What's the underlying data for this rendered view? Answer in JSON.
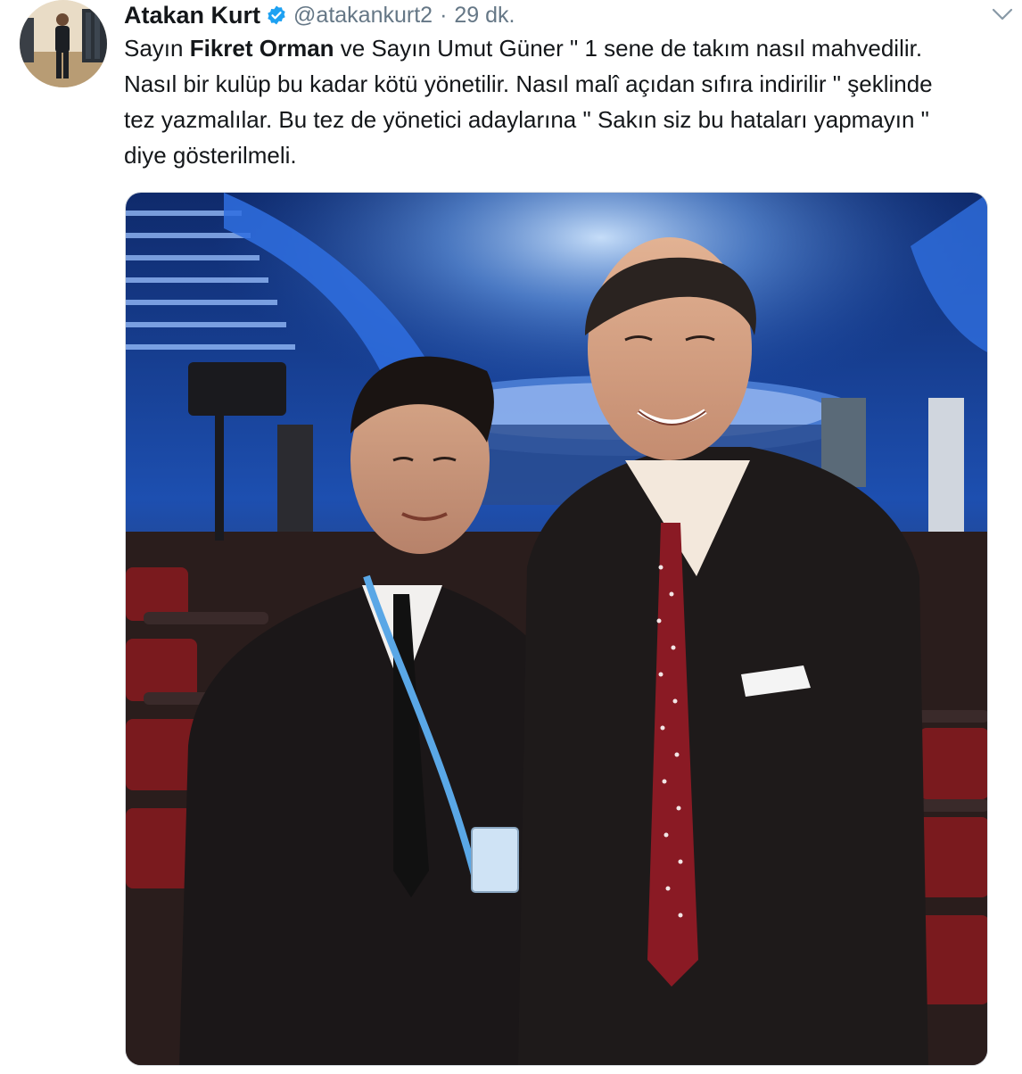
{
  "tweet": {
    "display_name": "Atakan Kurt",
    "handle": "@atakankurt2",
    "separator": "·",
    "timestamp": "29 dk.",
    "verified_icon": "verified-badge-icon",
    "more_icon": "chevron-down-icon",
    "text_lines": [
      {
        "pre": "Sayın ",
        "bold": "Fikret Orman",
        "post": " ve Sayın Umut Güner \" 1 sene de takım nasıl mahvedilir."
      },
      {
        "pre": "Nasıl bir kulüp bu kadar kötü yönetilir. Nasıl malî açıdan sıfıra indirilir \" şeklinde",
        "bold": "",
        "post": ""
      },
      {
        "pre": "tez yazmalılar. Bu tez de yönetici adaylarına \" Sakın siz bu hataları yapmayın \"",
        "bold": "",
        "post": ""
      },
      {
        "pre": "diye gösterilmeli.",
        "bold": "",
        "post": ""
      }
    ]
  },
  "colors": {
    "name": "#14171a",
    "secondary": "#657786",
    "verified": "#1da1f2",
    "border": "#d8dde2"
  }
}
